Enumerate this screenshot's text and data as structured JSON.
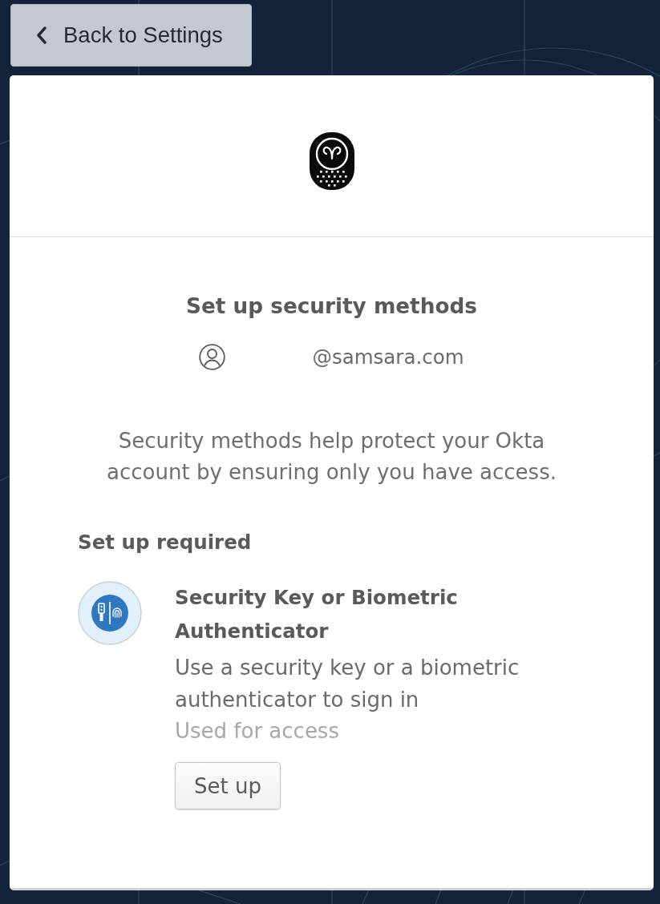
{
  "back_button": {
    "label": "Back to Settings"
  },
  "title": "Set up security methods",
  "user": {
    "email": "@samsara.com"
  },
  "description": "Security methods help protect your Okta account by ensuring only you have access.",
  "section": {
    "heading": "Set up required",
    "methods": [
      {
        "title": "Security Key or Biometric Authenticator",
        "description": "Use a security key or a biometric authenticator to sign in",
        "usage": "Used for access",
        "button": "Set up"
      }
    ]
  }
}
